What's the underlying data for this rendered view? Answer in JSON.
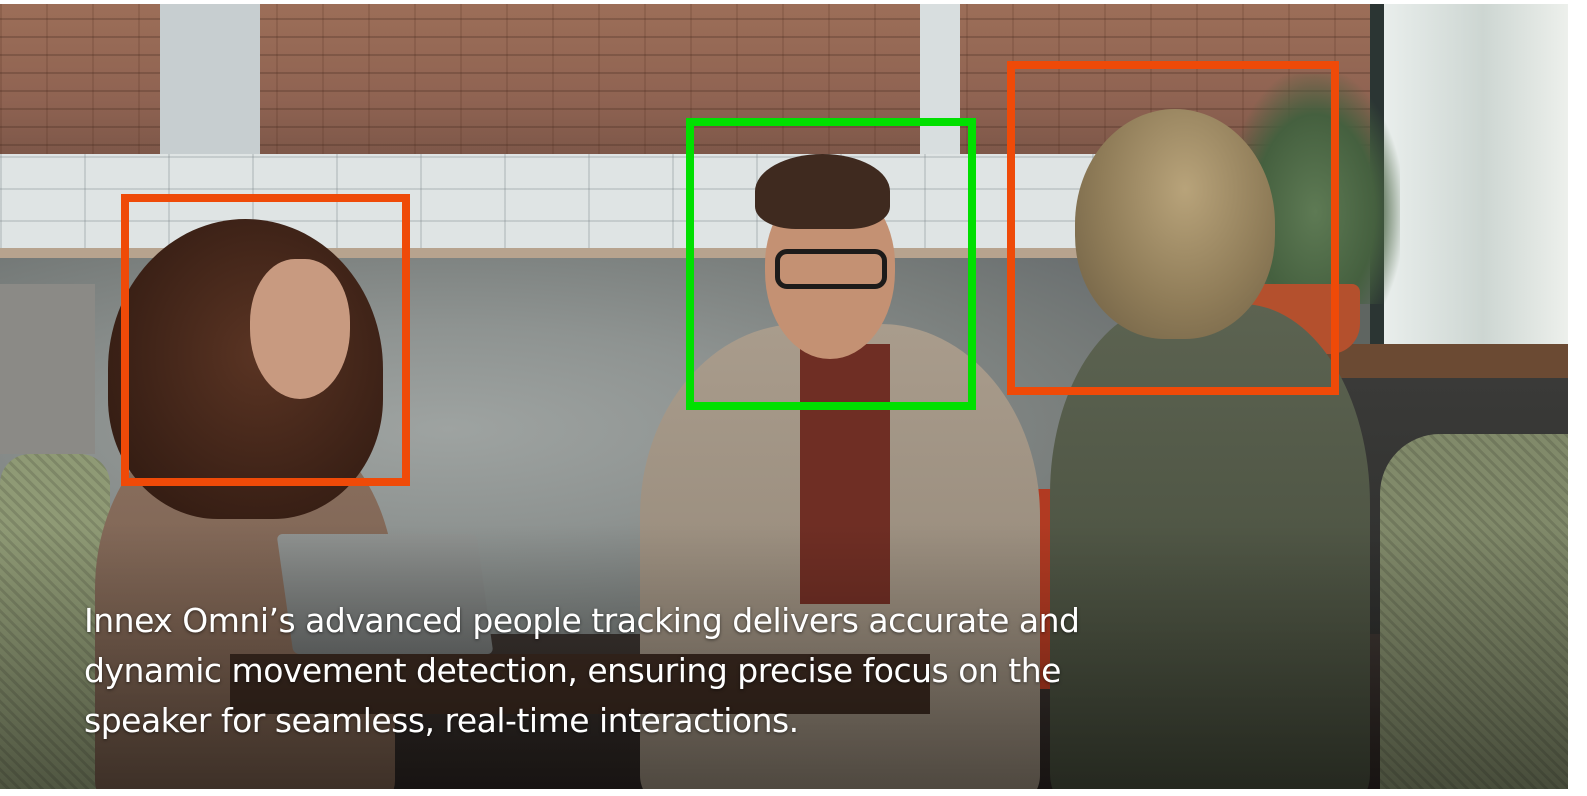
{
  "caption": {
    "text": "Innex Omni’s advanced people tracking delivers accurate and dynamic movement detection, ensuring precise focus on the speaker for seamless, real-time interactions."
  },
  "detections": {
    "active_speaker_color": "#00e000",
    "tracked_person_color": "#ef4a08"
  }
}
